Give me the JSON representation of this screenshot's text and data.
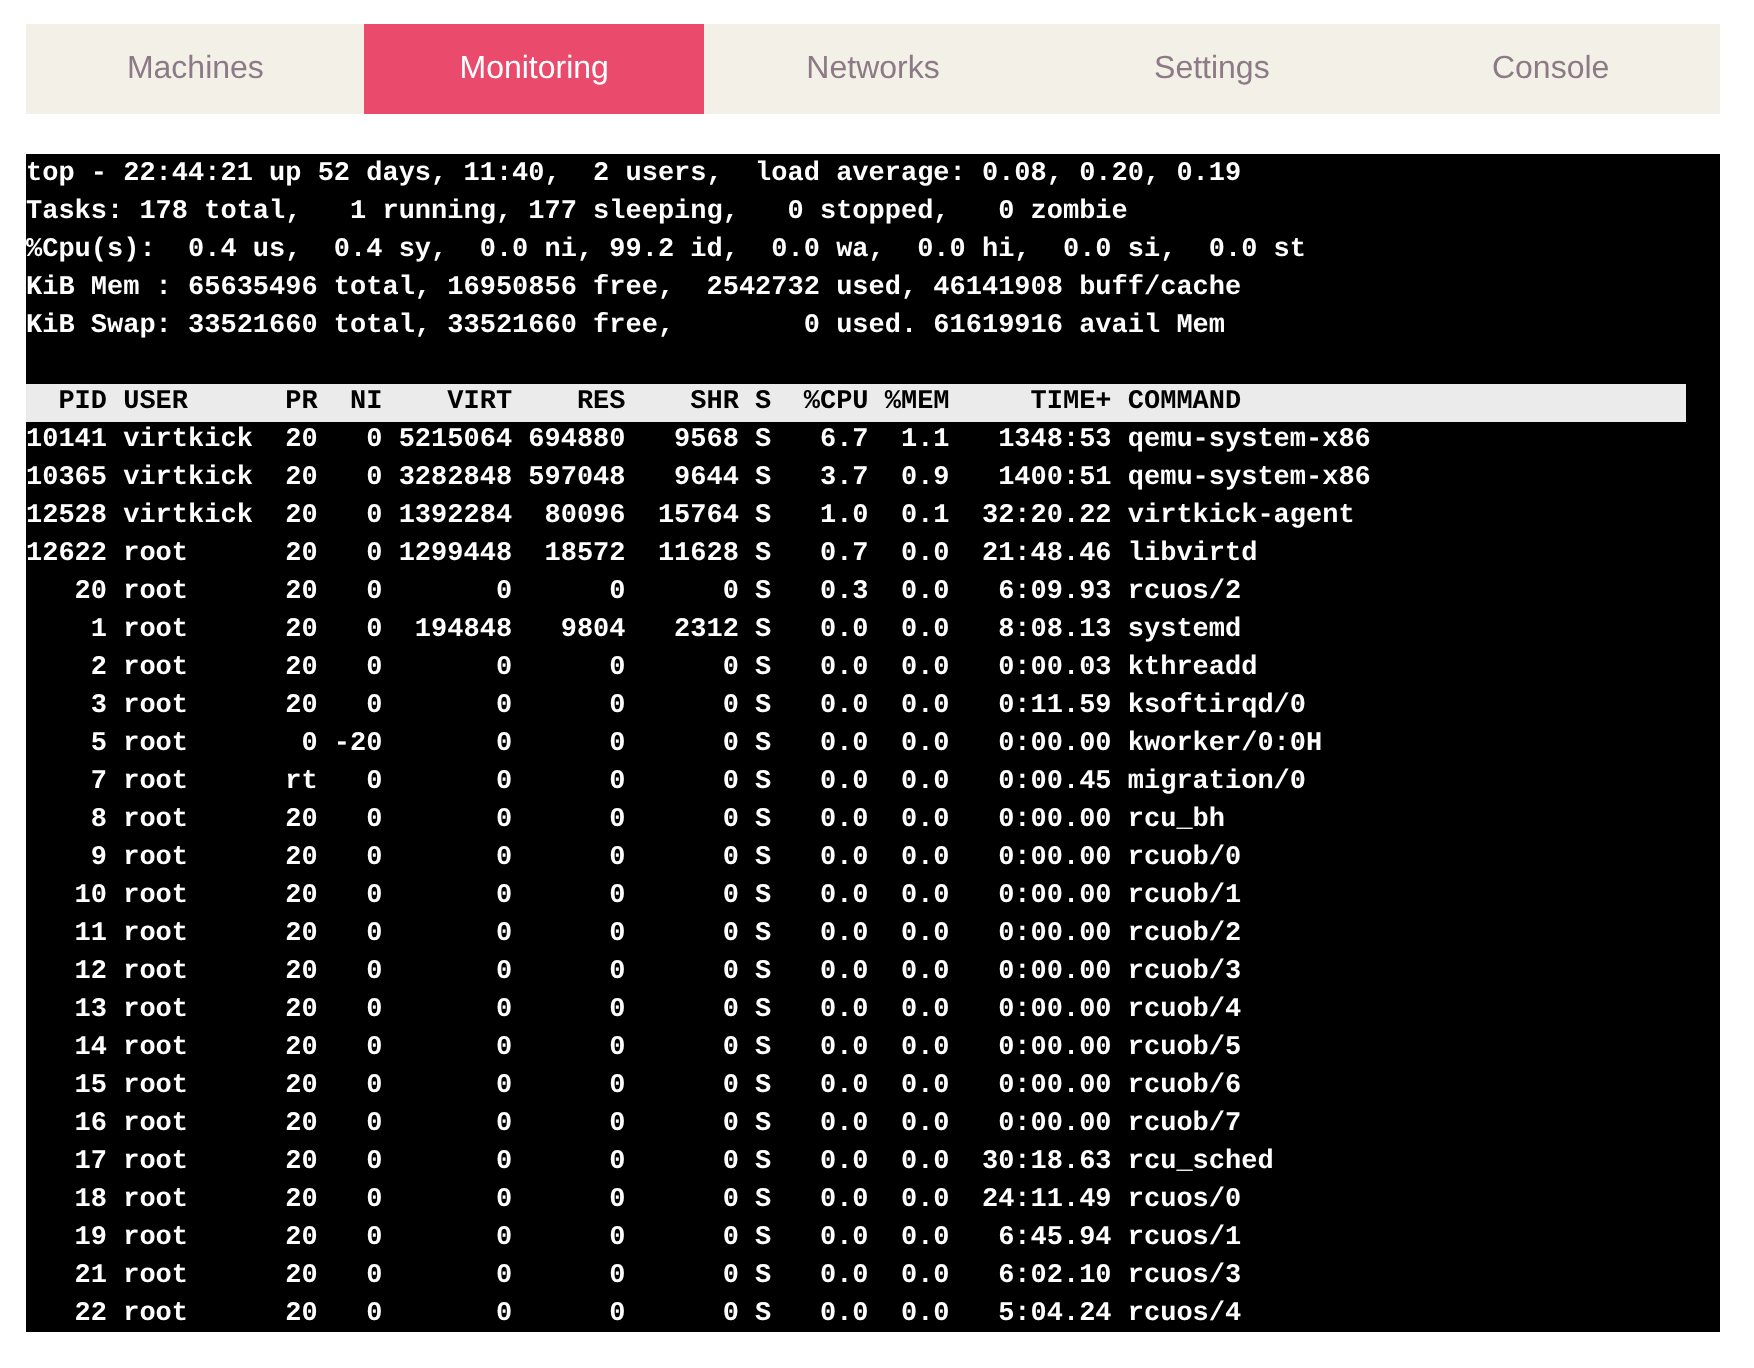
{
  "tabs": [
    {
      "label": "Machines",
      "selected": false
    },
    {
      "label": "Monitoring",
      "selected": true
    },
    {
      "label": "Networks",
      "selected": false
    },
    {
      "label": "Settings",
      "selected": false
    },
    {
      "label": "Console",
      "selected": false
    }
  ],
  "terminal": {
    "summary": [
      "top - 22:44:21 up 52 days, 11:40,  2 users,  load average: 0.08, 0.20, 0.19",
      "Tasks: 178 total,   1 running, 177 sleeping,   0 stopped,   0 zombie",
      "%Cpu(s):  0.4 us,  0.4 sy,  0.0 ni, 99.2 id,  0.0 wa,  0.0 hi,  0.0 si,  0.0 st",
      "KiB Mem : 65635496 total, 16950856 free,  2542732 used, 46141908 buff/cache",
      "KiB Swap: 33521660 total, 33521660 free,        0 used. 61619916 avail Mem"
    ],
    "header": "  PID USER      PR  NI    VIRT    RES    SHR S  %CPU %MEM     TIME+ COMMAND",
    "rows": [
      "10141 virtkick  20   0 5215064 694880   9568 S   6.7  1.1   1348:53 qemu-system-x86",
      "10365 virtkick  20   0 3282848 597048   9644 S   3.7  0.9   1400:51 qemu-system-x86",
      "12528 virtkick  20   0 1392284  80096  15764 S   1.0  0.1  32:20.22 virtkick-agent",
      "12622 root      20   0 1299448  18572  11628 S   0.7  0.0  21:48.46 libvirtd",
      "   20 root      20   0       0      0      0 S   0.3  0.0   6:09.93 rcuos/2",
      "    1 root      20   0  194848   9804   2312 S   0.0  0.0   8:08.13 systemd",
      "    2 root      20   0       0      0      0 S   0.0  0.0   0:00.03 kthreadd",
      "    3 root      20   0       0      0      0 S   0.0  0.0   0:11.59 ksoftirqd/0",
      "    5 root       0 -20       0      0      0 S   0.0  0.0   0:00.00 kworker/0:0H",
      "    7 root      rt   0       0      0      0 S   0.0  0.0   0:00.45 migration/0",
      "    8 root      20   0       0      0      0 S   0.0  0.0   0:00.00 rcu_bh",
      "    9 root      20   0       0      0      0 S   0.0  0.0   0:00.00 rcuob/0",
      "   10 root      20   0       0      0      0 S   0.0  0.0   0:00.00 rcuob/1",
      "   11 root      20   0       0      0      0 S   0.0  0.0   0:00.00 rcuob/2",
      "   12 root      20   0       0      0      0 S   0.0  0.0   0:00.00 rcuob/3",
      "   13 root      20   0       0      0      0 S   0.0  0.0   0:00.00 rcuob/4",
      "   14 root      20   0       0      0      0 S   0.0  0.0   0:00.00 rcuob/5",
      "   15 root      20   0       0      0      0 S   0.0  0.0   0:00.00 rcuob/6",
      "   16 root      20   0       0      0      0 S   0.0  0.0   0:00.00 rcuob/7",
      "   17 root      20   0       0      0      0 S   0.0  0.0  30:18.63 rcu_sched",
      "   18 root      20   0       0      0      0 S   0.0  0.0  24:11.49 rcuos/0",
      "   19 root      20   0       0      0      0 S   0.0  0.0   6:45.94 rcuos/1",
      "   21 root      20   0       0      0      0 S   0.0  0.0   6:02.10 rcuos/3",
      "   22 root      20   0       0      0      0 S   0.0  0.0   5:04.24 rcuos/4"
    ]
  }
}
